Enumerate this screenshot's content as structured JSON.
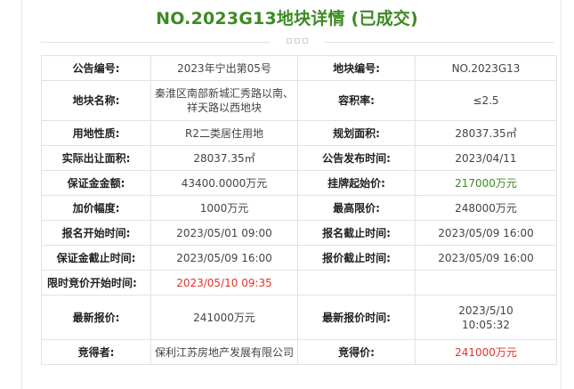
{
  "page": {
    "title": "NO.2023G13地块详情 (已成交)"
  },
  "colors": {
    "title_green": "#3d8a22",
    "highlight_green": "#3d8a22",
    "highlight_red": "#e0332b"
  },
  "rows": {
    "r1": {
      "label1": "公告编号:",
      "value1": "2023年宁出第05号",
      "label2": "地块编号:",
      "value2": "NO.2023G13"
    },
    "r2": {
      "label1": "地块名称:",
      "value1": "秦淮区南部新城汇秀路以南、祥天路以西地块",
      "label2": "容积率:",
      "value2": "≤2.5"
    },
    "r3": {
      "label1": "用地性质:",
      "value1": "R2二类居住用地",
      "label2": "规划面积:",
      "value2": "28037.35㎡"
    },
    "r4": {
      "label1": "实际出让面积:",
      "value1": "28037.35㎡",
      "label2": "公告发布时间:",
      "value2": "2023/04/11"
    },
    "r5": {
      "label1": "保证金金额:",
      "value1": "43400.0000万元",
      "label2": "挂牌起始价:",
      "value2": "217000万元"
    },
    "r6": {
      "label1": "加价幅度:",
      "value1": "1000万元",
      "label2": "最高限价:",
      "value2": "248000万元"
    },
    "r7": {
      "label1": "报名开始时间:",
      "value1": "2023/05/01 09:00",
      "label2": "报名截止时间:",
      "value2": "2023/05/09 16:00"
    },
    "r8": {
      "label1": "保证金截止时间:",
      "value1": "2023/05/09 16:00",
      "label2": "报价截止时间:",
      "value2": "2023/05/09 16:00"
    },
    "r9": {
      "label1": "限时竞价开始时间:",
      "value1": "2023/05/10 09:35"
    },
    "r10": {
      "label1": "最新报价:",
      "value1": "241000万元",
      "label2": "最新报价时间:",
      "value2_line1": "2023/5/10",
      "value2_line2": "10:05:32"
    },
    "r11": {
      "label1": "竞得者:",
      "value1": "保利江苏房地产发展有限公司",
      "label2": "竞得价:",
      "value2": "241000万元"
    }
  }
}
